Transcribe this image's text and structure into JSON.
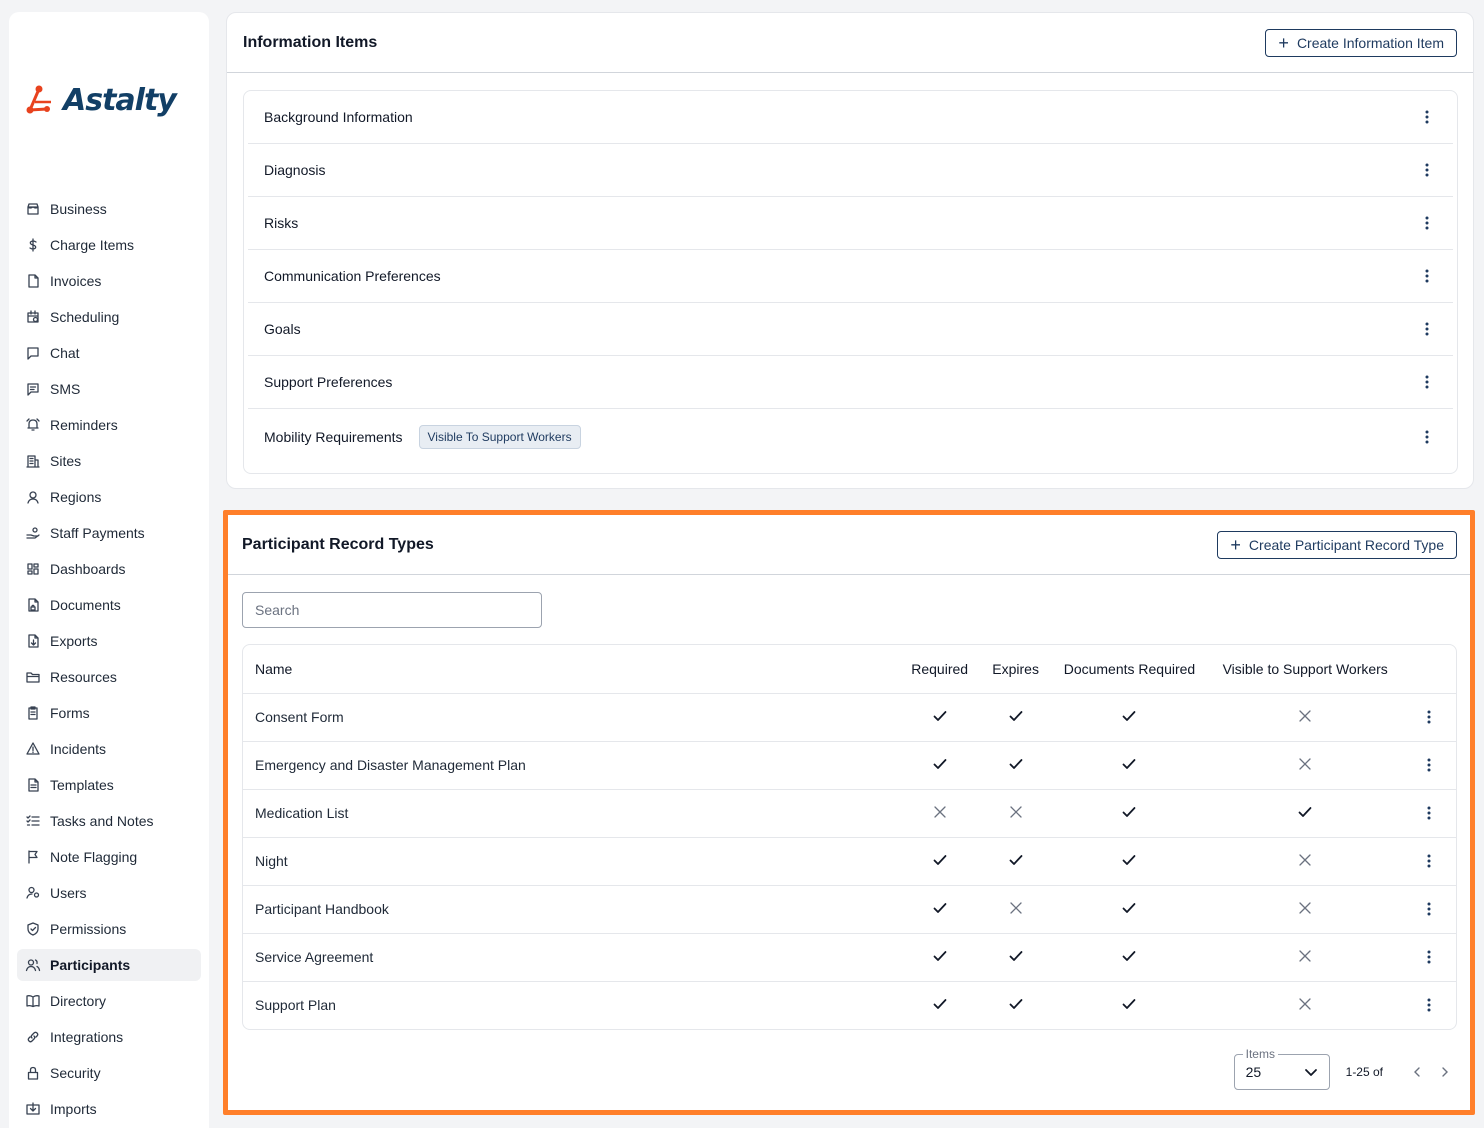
{
  "brand": {
    "name": "Astalty",
    "accent": "#ff7f2a",
    "primary": "#1e3a5f",
    "logo_red": "#e8421e"
  },
  "sidebar": {
    "items": [
      {
        "label": "Business",
        "icon": "store-icon"
      },
      {
        "label": "Charge Items",
        "icon": "dollar-icon"
      },
      {
        "label": "Invoices",
        "icon": "file-icon"
      },
      {
        "label": "Scheduling",
        "icon": "calendar-clock-icon"
      },
      {
        "label": "Chat",
        "icon": "chat-icon"
      },
      {
        "label": "SMS",
        "icon": "message-text-icon"
      },
      {
        "label": "Reminders",
        "icon": "bell-icon"
      },
      {
        "label": "Sites",
        "icon": "building-icon"
      },
      {
        "label": "Regions",
        "icon": "map-pin-icon"
      },
      {
        "label": "Staff Payments",
        "icon": "hand-coins-icon"
      },
      {
        "label": "Dashboards",
        "icon": "dashboard-icon"
      },
      {
        "label": "Documents",
        "icon": "file-lock-icon"
      },
      {
        "label": "Exports",
        "icon": "file-down-icon"
      },
      {
        "label": "Resources",
        "icon": "folder-icon"
      },
      {
        "label": "Forms",
        "icon": "clipboard-icon"
      },
      {
        "label": "Incidents",
        "icon": "warning-icon"
      },
      {
        "label": "Templates",
        "icon": "file-text-icon"
      },
      {
        "label": "Tasks and Notes",
        "icon": "list-checks-icon"
      },
      {
        "label": "Note Flagging",
        "icon": "flag-icon"
      },
      {
        "label": "Users",
        "icon": "user-cog-icon"
      },
      {
        "label": "Permissions",
        "icon": "shield-check-icon"
      },
      {
        "label": "Participants",
        "icon": "users-icon",
        "active": true
      },
      {
        "label": "Directory",
        "icon": "book-open-icon"
      },
      {
        "label": "Integrations",
        "icon": "link-icon"
      },
      {
        "label": "Security",
        "icon": "lock-icon"
      },
      {
        "label": "Imports",
        "icon": "import-icon"
      }
    ]
  },
  "info_items": {
    "title": "Information Items",
    "create_label": "Create Information Item",
    "items": [
      {
        "label": "Background Information"
      },
      {
        "label": "Diagnosis"
      },
      {
        "label": "Risks"
      },
      {
        "label": "Communication Preferences"
      },
      {
        "label": "Goals"
      },
      {
        "label": "Support Preferences"
      },
      {
        "label": "Mobility Requirements",
        "badge": "Visible To Support Workers"
      }
    ]
  },
  "record_types": {
    "title": "Participant Record Types",
    "create_label": "Create Participant Record Type",
    "search_placeholder": "Search",
    "columns": [
      "Name",
      "Required",
      "Expires",
      "Documents Required",
      "Visible to Support Workers"
    ],
    "rows": [
      {
        "name": "Consent Form",
        "required": true,
        "expires": true,
        "documents_required": true,
        "visible": false
      },
      {
        "name": "Emergency and Disaster Management Plan",
        "required": true,
        "expires": true,
        "documents_required": true,
        "visible": false
      },
      {
        "name": "Medication List",
        "required": false,
        "expires": false,
        "documents_required": true,
        "visible": true
      },
      {
        "name": "Night",
        "required": true,
        "expires": true,
        "documents_required": true,
        "visible": false
      },
      {
        "name": "Participant Handbook",
        "required": true,
        "expires": false,
        "documents_required": true,
        "visible": false
      },
      {
        "name": "Service Agreement",
        "required": true,
        "expires": true,
        "documents_required": true,
        "visible": false
      },
      {
        "name": "Support Plan",
        "required": true,
        "expires": true,
        "documents_required": true,
        "visible": false
      }
    ],
    "pagination": {
      "items_label": "Items",
      "items_value": "25",
      "range": "1-25 of"
    }
  }
}
